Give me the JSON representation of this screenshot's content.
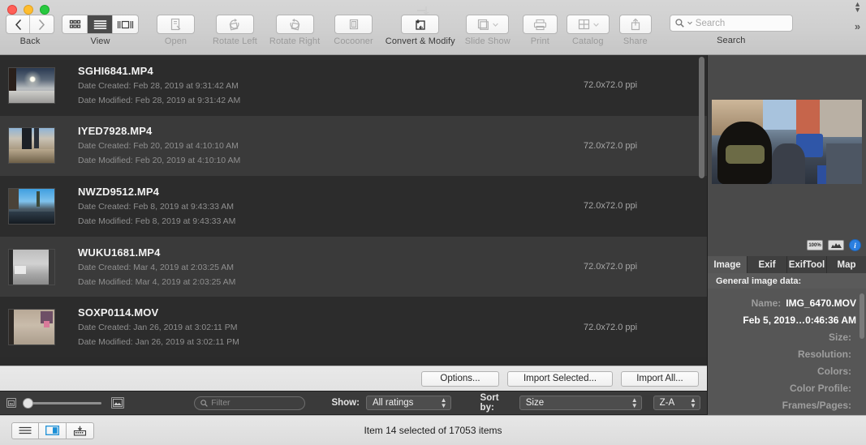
{
  "window": {
    "traffic_lights": [
      "close",
      "minimize",
      "zoom"
    ]
  },
  "toolbar": {
    "items": [
      {
        "name": "back",
        "label": "Back",
        "dim": false
      },
      {
        "name": "view",
        "label": "View",
        "dim": false
      },
      {
        "name": "open",
        "label": "Open",
        "dim": true
      },
      {
        "name": "rotate-left",
        "label": "Rotate Left",
        "dim": true
      },
      {
        "name": "rotate-right",
        "label": "Rotate Right",
        "dim": true
      },
      {
        "name": "cocooner",
        "label": "Cocooner",
        "dim": true
      },
      {
        "name": "convert-modify",
        "label": "Convert & Modify",
        "dim": false
      },
      {
        "name": "slide-show",
        "label": "Slide Show",
        "dim": true
      },
      {
        "name": "print",
        "label": "Print",
        "dim": true
      },
      {
        "name": "catalog",
        "label": "Catalog",
        "dim": true
      },
      {
        "name": "share",
        "label": "Share",
        "dim": true
      },
      {
        "name": "search",
        "label": "Search",
        "dim": false
      }
    ],
    "search_placeholder": "Search",
    "overflow_glyph": "»"
  },
  "file_list": {
    "date_created_label": "Date Created:",
    "date_modified_label": "Date Modified:",
    "rows": [
      {
        "filename": "SGHI6841.MP4",
        "date_created": "Date Created: Feb 28, 2019 at 9:31:42 AM",
        "date_modified": "Date Modified: Feb 28, 2019 at 9:31:42 AM",
        "resolution": "72.0x72.0 ppi"
      },
      {
        "filename": "IYED7928.MP4",
        "date_created": "Date Created: Feb 20, 2019 at 4:10:10 AM",
        "date_modified": "Date Modified: Feb 20, 2019 at 4:10:10 AM",
        "resolution": "72.0x72.0 ppi"
      },
      {
        "filename": "NWZD9512.MP4",
        "date_created": "Date Created: Feb 8, 2019 at 9:43:33 AM",
        "date_modified": "Date Modified: Feb 8, 2019 at 9:43:33 AM",
        "resolution": "72.0x72.0 ppi"
      },
      {
        "filename": "WUKU1681.MP4",
        "date_created": "Date Created: Mar 4, 2019 at 2:03:25 AM",
        "date_modified": "Date Modified: Mar 4, 2019 at 2:03:25 AM",
        "resolution": "72.0x72.0 ppi"
      },
      {
        "filename": "SOXP0114.MOV",
        "date_created": "Date Created: Jan 26, 2019 at 3:02:11 PM",
        "date_modified": "Date Modified: Jan 26, 2019 at 3:02:11 PM",
        "resolution": "72.0x72.0 ppi"
      }
    ]
  },
  "actions": {
    "options": "Options...",
    "import_selected": "Import Selected...",
    "import_all": "Import All..."
  },
  "filter_bar": {
    "filter_placeholder": "Filter",
    "show_label": "Show:",
    "show_value": "All ratings",
    "sort_label": "Sort by:",
    "sort_value": "Size",
    "order_value": "Z-A"
  },
  "inspector": {
    "tabs": [
      {
        "label": "Image",
        "selected": true
      },
      {
        "label": "Exif",
        "selected": false
      },
      {
        "label": "ExifTool",
        "selected": false
      },
      {
        "label": "Map",
        "selected": false
      }
    ],
    "section_header": "General image data:",
    "preview_tools": [
      {
        "name": "zoom-100-percent",
        "label": "100%"
      },
      {
        "name": "histogram",
        "label": ""
      },
      {
        "name": "info",
        "label": "i"
      }
    ],
    "properties": [
      {
        "key": "Name:",
        "value": "IMG_6470.MOV"
      },
      {
        "key": "",
        "value": "Feb 5, 2019…0:46:36 AM"
      },
      {
        "key": "Size:",
        "value": ""
      },
      {
        "key": "Resolution:",
        "value": ""
      },
      {
        "key": "Colors:",
        "value": ""
      },
      {
        "key": "Color Profile:",
        "value": ""
      },
      {
        "key": "Frames/Pages:",
        "value": ""
      }
    ]
  },
  "status_bar": {
    "text": "Item 14 selected of 17053 items",
    "buttons": [
      {
        "name": "list-view-toggle",
        "selected": false
      },
      {
        "name": "panel-view-toggle",
        "selected": true
      },
      {
        "name": "import-device-toggle",
        "selected": false
      }
    ]
  },
  "colors": {
    "accent": "#2b7fe0",
    "list_bg_odd": "#2c2c2c",
    "list_bg_even": "#3a3a3a",
    "chrome": "#d0d0d0"
  }
}
